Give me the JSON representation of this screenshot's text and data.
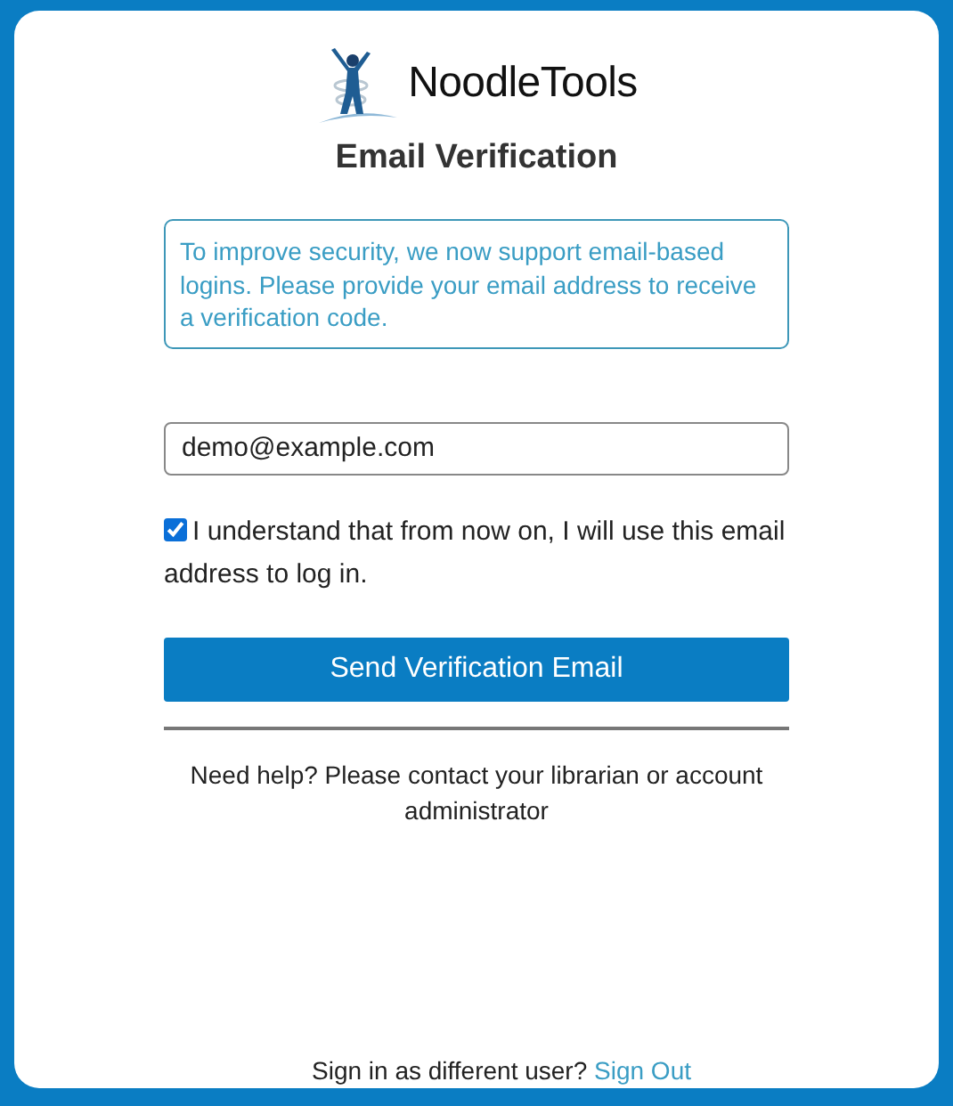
{
  "logo": {
    "text": "NoodleTools"
  },
  "title": "Email Verification",
  "notice": "To improve security, we now support email-based logins. Please provide your email address to receive a verification code.",
  "email_field": {
    "value": "demo@example.com"
  },
  "agreement": {
    "label": "I understand that from now on, I will use this email address to log in.",
    "checked": true
  },
  "submit_button": "Send Verification Email",
  "help_text": "Need help? Please contact your librarian or account administrator",
  "footer": {
    "text": "Sign in as different user?",
    "link": "Sign Out"
  }
}
